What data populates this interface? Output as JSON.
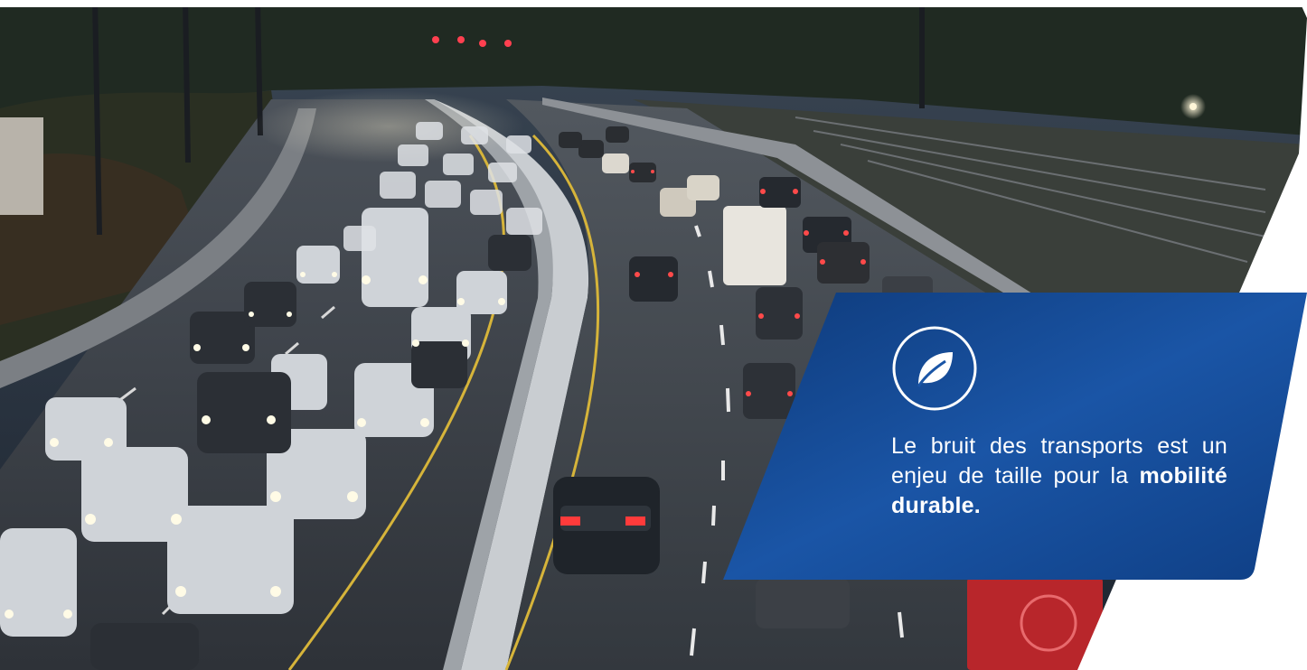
{
  "scene": {
    "description_icon": "highway-traffic-photo"
  },
  "panel": {
    "icon": "leaf-icon",
    "text_line1": "Le bruit des transports est",
    "text_line2": "un enjeu de taille pour la",
    "text_bold": "mobilité durable.",
    "colors": {
      "panel_dark": "#0d3a78",
      "panel_light": "#1c5fb3",
      "text": "#ffffff"
    }
  }
}
